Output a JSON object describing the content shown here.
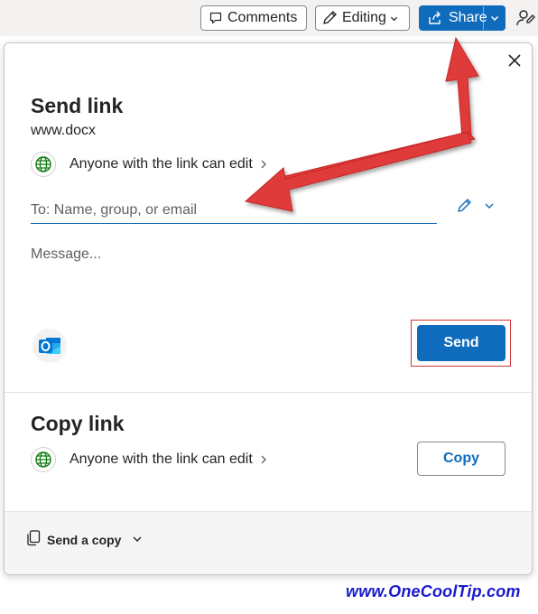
{
  "toolbar": {
    "comments_label": "Comments",
    "editing_label": "Editing",
    "share_label": "Share"
  },
  "send_link": {
    "title": "Send link",
    "file_name": "www.docx",
    "permission_label": "Anyone with the link can edit",
    "to_placeholder": "To: Name, group, or email",
    "message_placeholder": "Message...",
    "send_label": "Send"
  },
  "copy_link": {
    "title": "Copy link",
    "permission_label": "Anyone with the link can edit",
    "copy_label": "Copy"
  },
  "footer": {
    "send_copy_label": "Send a copy"
  },
  "watermark": "www.OneCoolTip.com",
  "colors": {
    "accent": "#0f6cbd",
    "annotation_arrow": "#e03a3a",
    "highlight_box": "#d13438",
    "globe_green": "#107c10",
    "outlook_blue": "#0078d4",
    "watermark": "#1a1acc"
  },
  "icons": {
    "comments": "comment-icon",
    "editing": "pencil-icon",
    "share": "share-icon",
    "person": "person-feedback-icon",
    "close": "close-icon",
    "globe": "globe-icon",
    "outlook": "outlook-icon",
    "copy": "copy-icon"
  }
}
